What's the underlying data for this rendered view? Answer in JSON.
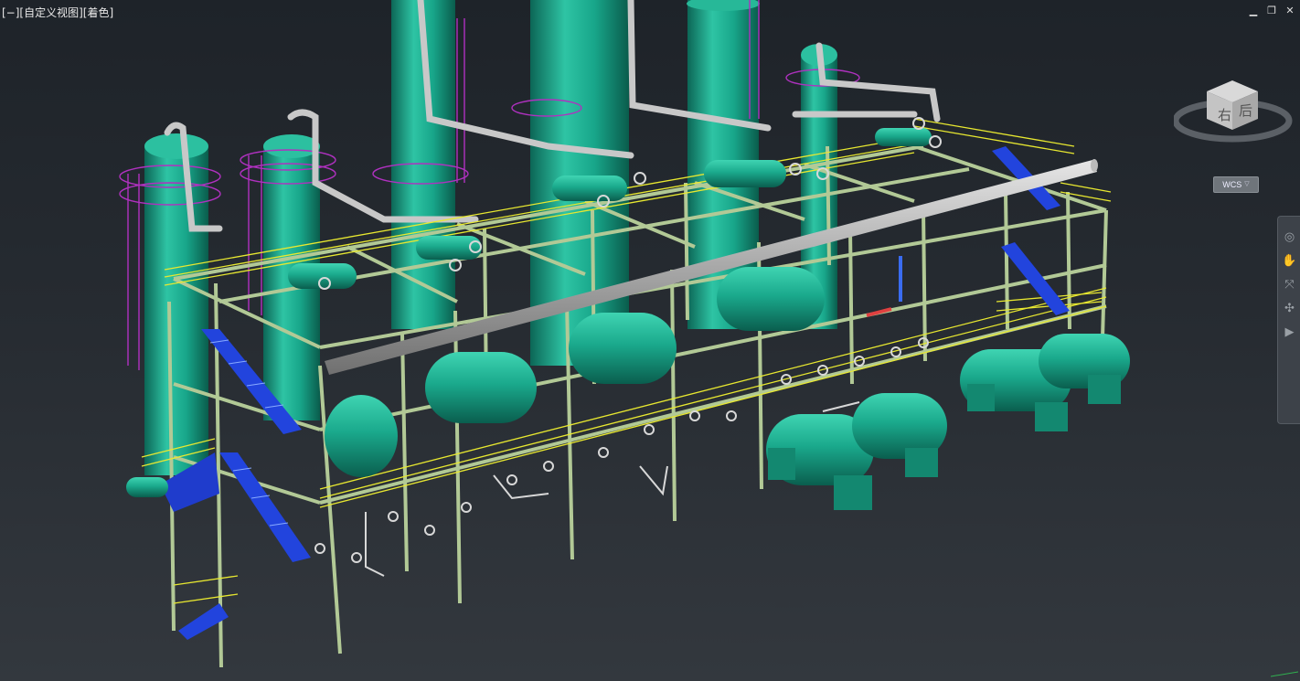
{
  "viewport": {
    "label": "[−][自定义视图][着色]"
  },
  "window_controls": {
    "minimize": "▁",
    "restore": "❐",
    "close": "✕"
  },
  "viewcube": {
    "right_face": "右",
    "back_face": "后"
  },
  "wcs": {
    "label": "WCS",
    "caret": "▽"
  },
  "navbar": {
    "tools": [
      "steering-wheel-icon",
      "pan-hand-icon",
      "zoom-icon",
      "orbit-icon",
      "showmotion-icon"
    ]
  },
  "colors": {
    "background": "#262b31",
    "vessel": "#1a9e86",
    "structure_steel": "#b2c996",
    "handrail": "#e8e830",
    "stair": "#2244dd",
    "ladder": "#b031c0",
    "pipe": "#c8c8c8"
  }
}
